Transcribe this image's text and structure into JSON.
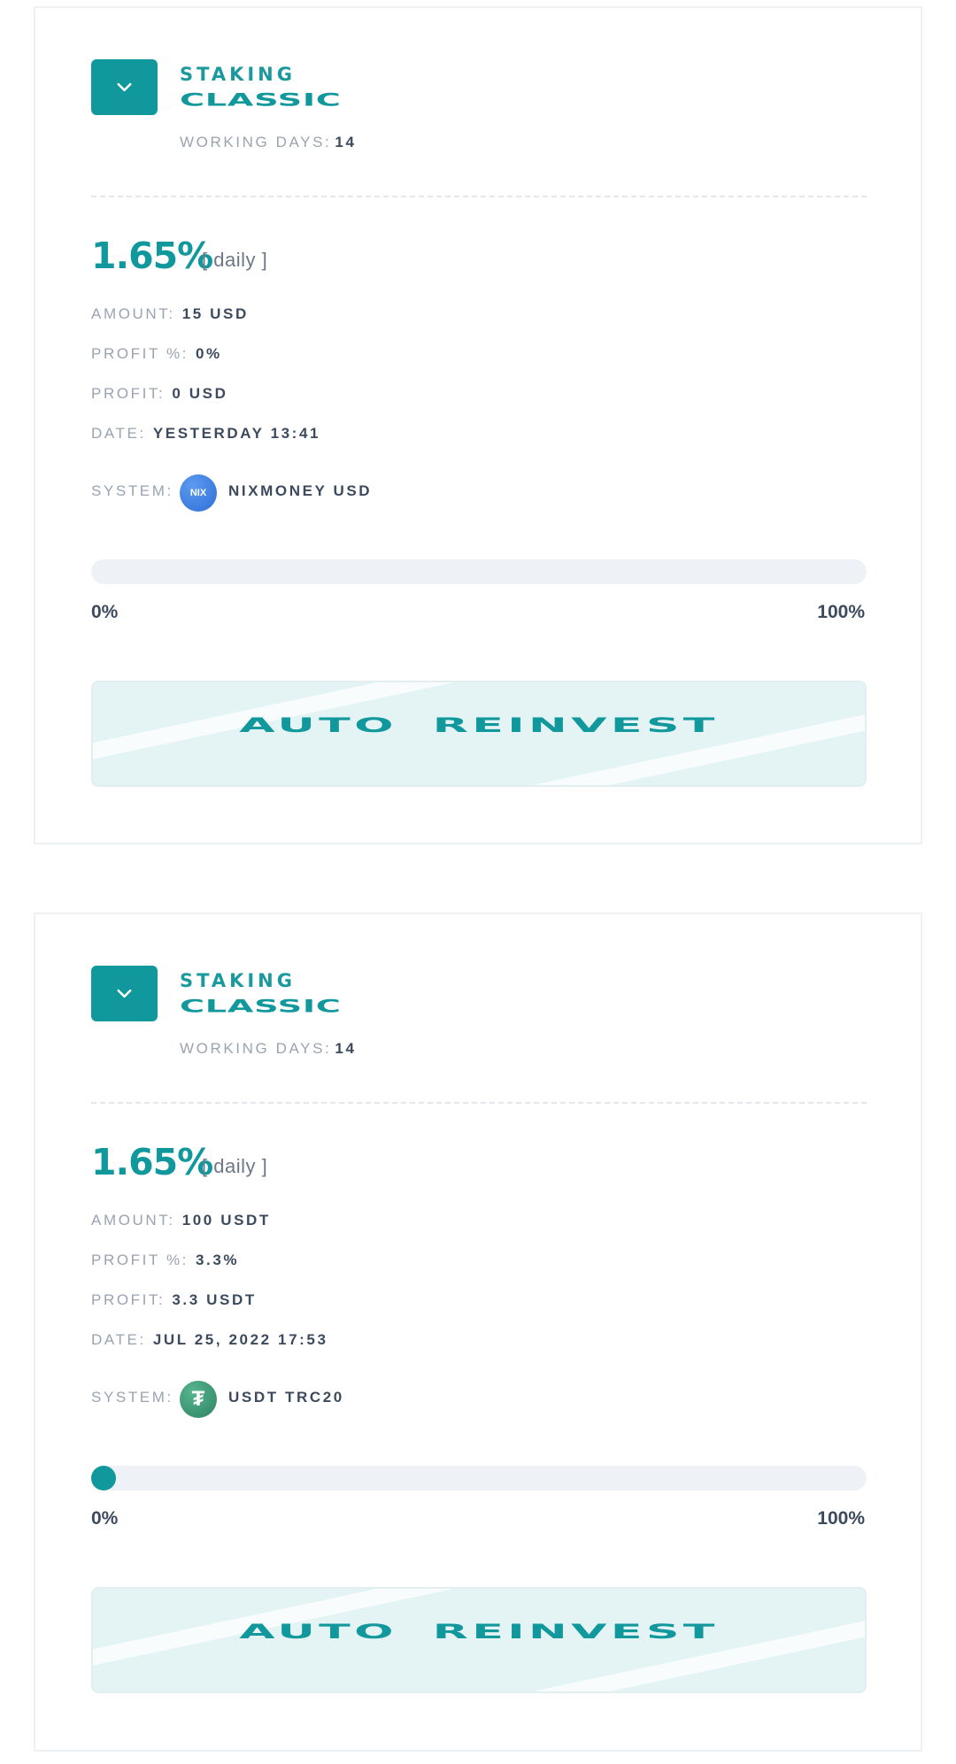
{
  "deposits": [
    {
      "plan_type": "STAKING",
      "plan_name": "CLASSIC",
      "working_days_label": "WORKING DAYS:",
      "working_days": "14",
      "rate": "1.65%",
      "rate_period": "[ daily ]",
      "amount_label": "AMOUNT:",
      "amount": "15 USD",
      "profit_pct_label": "PROFIT %:",
      "profit_pct": "0%",
      "profit_label": "PROFIT:",
      "profit": "0 USD",
      "date_label": "DATE:",
      "date": "YESTERDAY 13:41",
      "system_label": "SYSTEM:",
      "system_icon": "nixmoney-coin-icon",
      "system_icon_text": "NIX",
      "system": "NIXMONEY USD",
      "progress_fraction": 0.0,
      "progress_min": "0%",
      "progress_max": "100%",
      "reinvest_label": "AUTO REINVEST"
    },
    {
      "plan_type": "STAKING",
      "plan_name": "CLASSIC",
      "working_days_label": "WORKING DAYS:",
      "working_days": "14",
      "rate": "1.65%",
      "rate_period": "[ daily ]",
      "amount_label": "AMOUNT:",
      "amount": "100 USDT",
      "profit_pct_label": "PROFIT %:",
      "profit_pct": "3.3%",
      "profit_label": "PROFIT:",
      "profit": "3.3 USDT",
      "date_label": "DATE:",
      "date": "JUL 25, 2022 17:53",
      "system_label": "SYSTEM:",
      "system_icon": "tether-coin-icon",
      "system_icon_text": "₮",
      "system": "USDT TRC20",
      "progress_fraction": 0.02,
      "progress_min": "0%",
      "progress_max": "100%",
      "reinvest_label": "AUTO REINVEST"
    }
  ],
  "colors": {
    "accent": "#10989c",
    "muted_label": "#9aa3b1",
    "value_text": "#3c4a5e",
    "track": "#eef2f6"
  }
}
